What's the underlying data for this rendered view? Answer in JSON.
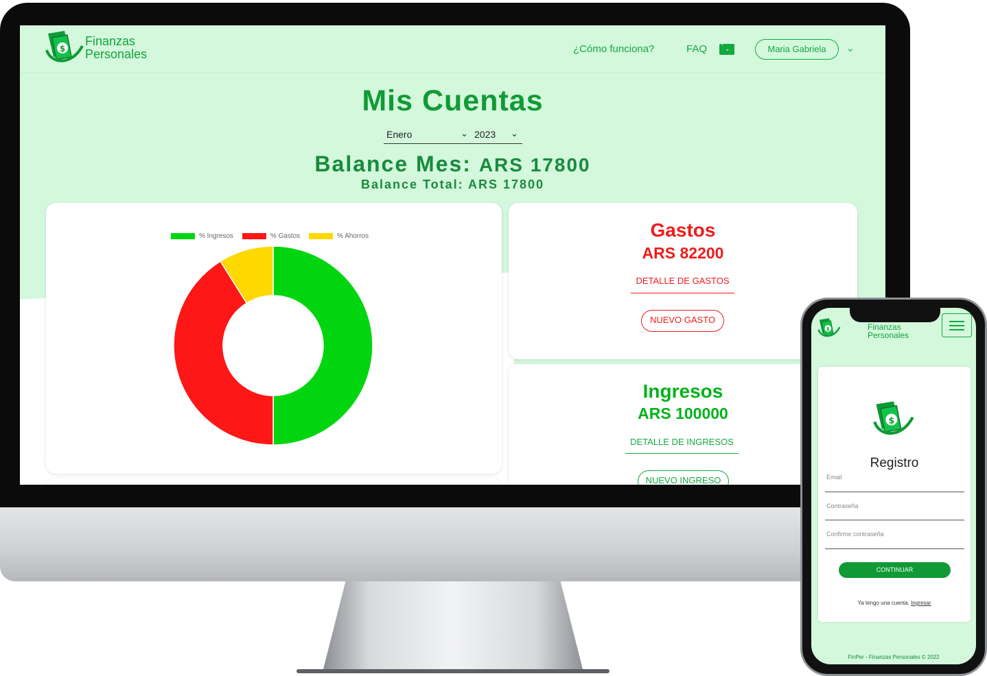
{
  "desktop": {
    "brand": {
      "line1": "Finanzas",
      "line2": "Personales"
    },
    "nav": {
      "how": "¿Cómo funciona?",
      "faq": "FAQ",
      "user": "Maria Gabriela"
    },
    "title": "Mis Cuentas",
    "month_select": "Enero",
    "year_select": "2023",
    "balance_month_label": "Balance Mes:",
    "balance_month_value": "ARS 17800",
    "balance_total": "Balance Total: ARS 17800",
    "gastos": {
      "title": "Gastos",
      "amount": "ARS 82200",
      "detail": "DETALLE DE GASTOS",
      "new": "NUEVO GASTO"
    },
    "ingresos": {
      "title": "Ingresos",
      "amount": "ARS 100000",
      "detail": "DETALLE DE INGRESOS",
      "new": "NUEVO INGRESO"
    }
  },
  "chart_data": {
    "type": "pie",
    "categories": [
      "% Ingresos",
      "% Gastos",
      "% Ahorros"
    ],
    "values": [
      50,
      41.1,
      8.9
    ],
    "colors": [
      "#00d50f",
      "#fe1717",
      "#ffd800"
    ],
    "legend_position": "top"
  },
  "mobile": {
    "brand": {
      "line1": "Finanzas",
      "line2": "Personales"
    },
    "title": "Registro",
    "email_label": "Email",
    "password_label": "Contraseña",
    "confirm_label": "Confirme contraseña",
    "continue": "CONTINUAR",
    "have_account": "Ya tengo una cuenta.",
    "login_link": "Ingresar",
    "footer": "FinPer - Finanzas Personales © 2022"
  },
  "colors": {
    "accent": "#13a93f",
    "background": "#d3f8dc",
    "danger": "#fe1717"
  }
}
